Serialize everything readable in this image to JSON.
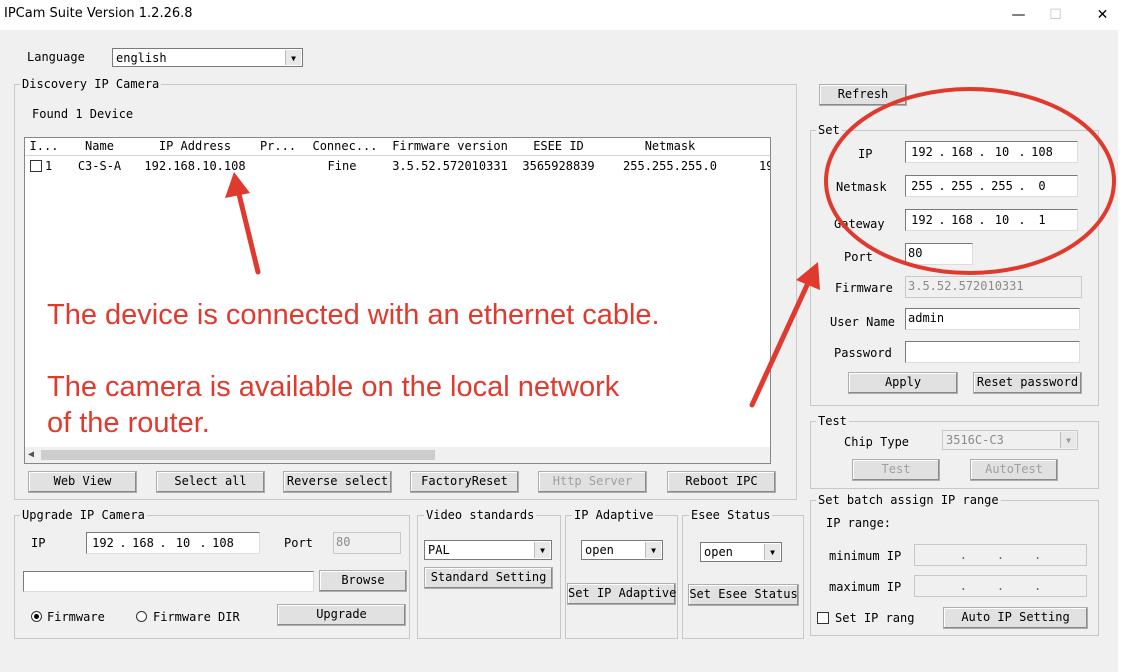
{
  "window": {
    "title": "IPCam Suite Version 1.2.26.8",
    "minimize": "—",
    "maximize": "☐",
    "close": "✕"
  },
  "language": {
    "label": "Language",
    "value": "english"
  },
  "discovery": {
    "title": "Discovery IP Camera",
    "found": "Found 1 Device",
    "columns": [
      "I...",
      "Name",
      "IP Address",
      "Pr...",
      "Connec...",
      "Firmware version",
      "ESEE ID",
      "Netmask"
    ],
    "rows": [
      {
        "index": "1",
        "name": "C3-S-A",
        "ip": "192.168.10.108",
        "protocol": "",
        "connection": "Fine",
        "firmware": "3.5.52.572010331",
        "esee_id": "3565928839",
        "netmask": "255.255.255.0",
        "overflow": "19"
      }
    ]
  },
  "annotations": {
    "line1": "The device is connected with an ethernet cable.",
    "line2": "The camera is available on the local network",
    "line3": "of the router.",
    "color": "#e03a2e"
  },
  "toolbar": {
    "web_view": "Web View",
    "select_all": "Select all",
    "reverse_select": "Reverse select",
    "factory_reset": "FactoryReset",
    "http_server": "Http Server",
    "reboot": "Reboot IPC"
  },
  "refresh": "Refresh",
  "set": {
    "title": "Set",
    "ip_label": "IP",
    "ip": [
      "192",
      "168",
      "10",
      "108"
    ],
    "netmask_label": "Netmask",
    "netmask": [
      "255",
      "255",
      "255",
      "0"
    ],
    "gateway_label": "Gateway",
    "gateway": [
      "192",
      "168",
      "10",
      "1"
    ],
    "port_label": "Port",
    "port": "80",
    "firmware_label": "Firmware",
    "firmware": "3.5.52.572010331",
    "username_label": "User Name",
    "username": "admin",
    "password_label": "Password",
    "password": "",
    "apply": "Apply",
    "reset_password": "Reset password"
  },
  "test": {
    "title": "Test",
    "chip_label": "Chip Type",
    "chip": "3516C-C3",
    "test": "Test",
    "autotest": "AutoTest"
  },
  "batch": {
    "title": "Set batch assign IP range",
    "range_label": "IP range:",
    "min_label": "minimum IP",
    "max_label": "maximum IP",
    "set_ip_rang": "Set IP rang",
    "auto_ip": "Auto IP Setting"
  },
  "upgrade": {
    "title": "Upgrade IP Camera",
    "ip_label": "IP",
    "ip": [
      "192",
      "168",
      "10",
      "108"
    ],
    "port_label": "Port",
    "port": "80",
    "browse": "Browse",
    "firmware": "Firmware",
    "firmware_dir": "Firmware DIR",
    "upgrade": "Upgrade"
  },
  "video": {
    "title": "Video standards",
    "value": "PAL",
    "button": "Standard Setting"
  },
  "ipadaptive": {
    "title": "IP Adaptive",
    "value": "open",
    "button": "Set IP Adaptive"
  },
  "esee": {
    "title": "Esee Status",
    "value": "open",
    "button": "Set Esee Status"
  },
  "colors": {
    "annotation_red": "#e03a2e",
    "window_bg": "#f0f0f0"
  }
}
